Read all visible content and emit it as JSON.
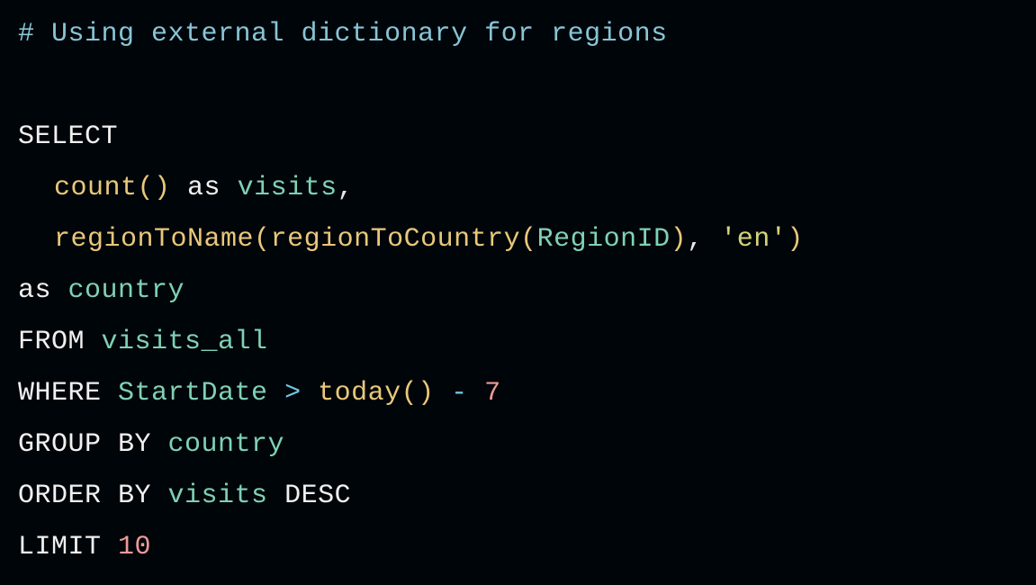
{
  "code": {
    "comment": "# Using external dictionary for regions",
    "line1": {
      "select": "SELECT"
    },
    "line2": {
      "count": "count",
      "paren_open": "(",
      "paren_close": ")",
      "as": " as ",
      "visits": "visits",
      "comma": ","
    },
    "line3": {
      "regionToName": "regionToName",
      "paren1": "(",
      "regionToCountry": "regionToCountry",
      "paren2": "(",
      "RegionID": "RegionID",
      "paren3": ")",
      "comma": ", ",
      "string_en": "'en'",
      "paren4": ")"
    },
    "line4": {
      "as": "as ",
      "country": "country"
    },
    "line5": {
      "from": "FROM ",
      "visits_all": "visits_all"
    },
    "line6": {
      "where": "WHERE ",
      "StartDate": "StartDate",
      "gt": " > ",
      "today": "today",
      "paren_open": "(",
      "paren_close": ")",
      "minus": " - ",
      "seven": "7"
    },
    "line7": {
      "groupby": "GROUP BY ",
      "country": "country"
    },
    "line8": {
      "orderby": "ORDER BY ",
      "visits": "visits",
      "desc": " DESC"
    },
    "line9": {
      "limit": "LIMIT ",
      "ten": "10"
    }
  }
}
